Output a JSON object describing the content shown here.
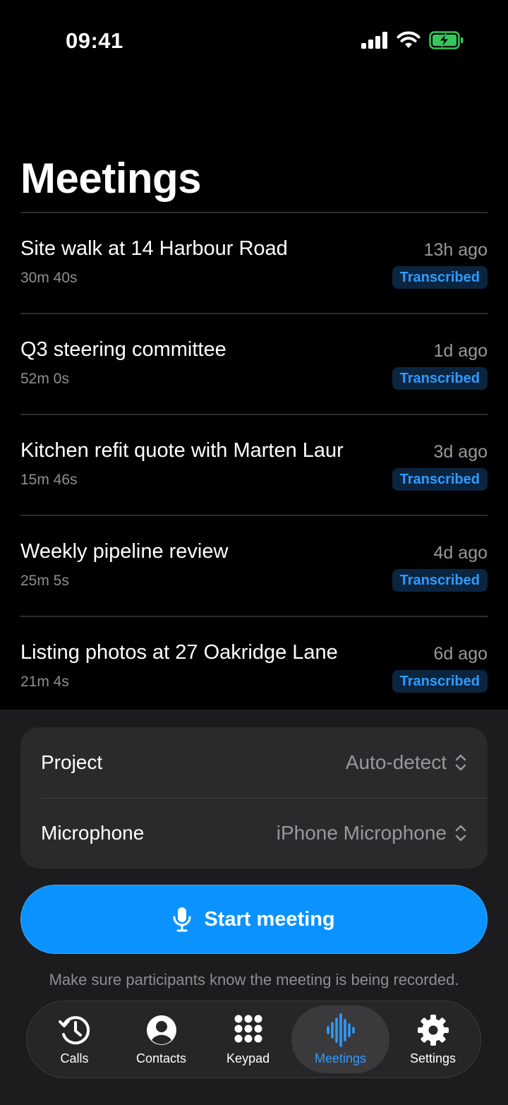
{
  "status_bar": {
    "time": "09:41"
  },
  "page": {
    "title": "Meetings"
  },
  "meetings": [
    {
      "title": "Site walk at 14 Harbour Road",
      "duration": "30m 40s",
      "time_ago": "13h ago",
      "status": "Transcribed"
    },
    {
      "title": "Q3 steering committee",
      "duration": "52m 0s",
      "time_ago": "1d ago",
      "status": "Transcribed"
    },
    {
      "title": "Kitchen refit quote with Marten Laur",
      "duration": "15m 46s",
      "time_ago": "3d ago",
      "status": "Transcribed"
    },
    {
      "title": "Weekly pipeline review",
      "duration": "25m 5s",
      "time_ago": "4d ago",
      "status": "Transcribed"
    },
    {
      "title": "Listing photos at 27 Oakridge Lane",
      "duration": "21m 4s",
      "time_ago": "6d ago",
      "status": "Transcribed"
    }
  ],
  "settings": {
    "project": {
      "label": "Project",
      "value": "Auto-detect"
    },
    "microphone": {
      "label": "Microphone",
      "value": "iPhone Microphone"
    }
  },
  "start_button": {
    "label": "Start meeting",
    "icon": "microphone-icon"
  },
  "disclaimer": "Make sure participants know the meeting is being recorded.",
  "tab_bar": {
    "tabs": [
      {
        "label": "Calls",
        "icon": "clock-history-icon",
        "active": false
      },
      {
        "label": "Contacts",
        "icon": "person-circle-icon",
        "active": false
      },
      {
        "label": "Keypad",
        "icon": "keypad-grid-icon",
        "active": false
      },
      {
        "label": "Meetings",
        "icon": "waveform-icon",
        "active": true
      },
      {
        "label": "Settings",
        "icon": "gear-icon",
        "active": false
      }
    ]
  },
  "colors": {
    "accent": "#0a93ff",
    "accent_text": "#2f9bff",
    "battery": "#34c759"
  }
}
